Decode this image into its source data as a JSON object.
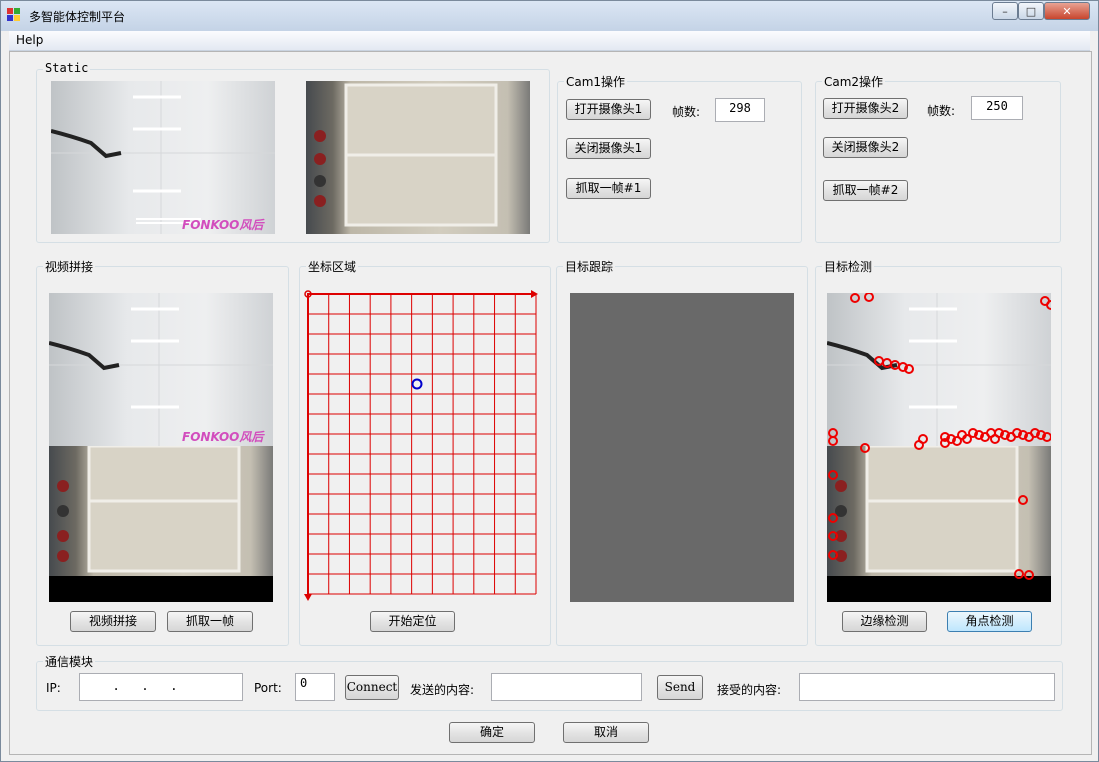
{
  "window": {
    "title": "多智能体控制平台",
    "controls": {
      "minimize": "–",
      "maximize": "□",
      "close": "✕"
    }
  },
  "menu": {
    "help": "Help"
  },
  "static": {
    "label": "Static",
    "watermark": "FONKOO风后"
  },
  "cam1": {
    "label": "Cam1操作",
    "open": "打开摄像头1",
    "close": "关闭摄像头1",
    "grab": "抓取一帧#1",
    "fps_label": "帧数:",
    "fps_value": "298"
  },
  "cam2": {
    "label": "Cam2操作",
    "open": "打开摄像头2",
    "close": "关闭摄像头2",
    "grab": "抓取一帧#2",
    "fps_label": "帧数:",
    "fps_value": "250"
  },
  "stitch": {
    "label": "视频拼接",
    "stitch_button": "视频拼接",
    "grab_button": "抓取一帧"
  },
  "coords": {
    "label": "坐标区域",
    "locate_button": "开始定位",
    "grid_color": "#dd0000",
    "marker_color": "#0000cc"
  },
  "tracking": {
    "label": "目标跟踪"
  },
  "detect": {
    "label": "目标检测",
    "edge_button": "边缘检测",
    "corner_button": "角点检测"
  },
  "comm": {
    "label": "通信模块",
    "ip_label": "IP:",
    "ip_value": "  .   .   .",
    "port_label": "Port:",
    "port_value": "0",
    "connect_button": "Connect",
    "send_label": "发送的内容:",
    "send_button": "Send",
    "recv_label": "接受的内容:"
  },
  "footer": {
    "ok": "确定",
    "cancel": "取消"
  }
}
